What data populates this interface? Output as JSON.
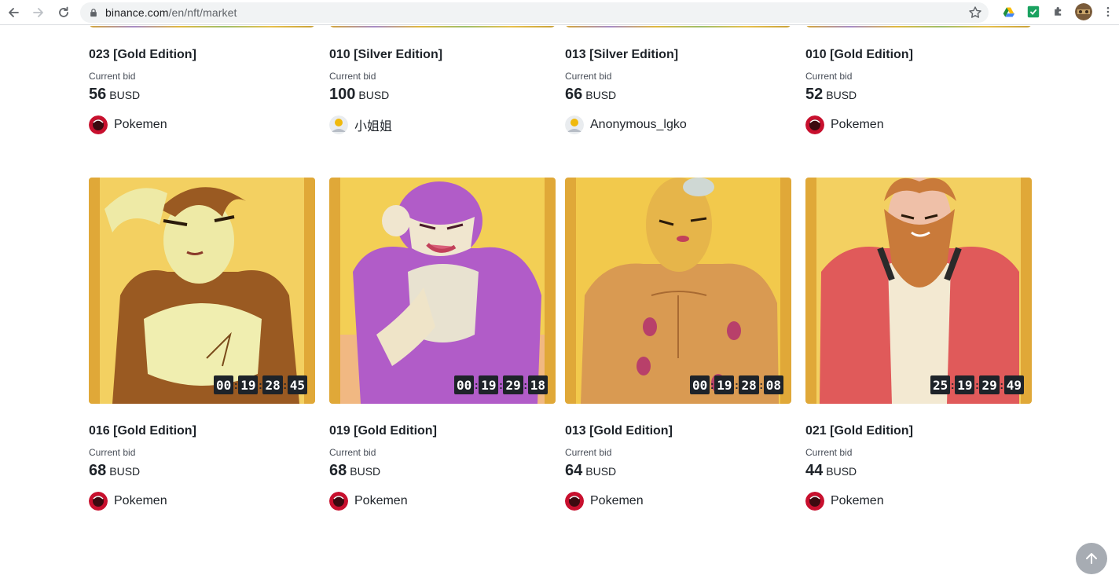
{
  "browser": {
    "url_host": "binance.com",
    "url_path": "/en/nft/market"
  },
  "top_row": [
    {
      "title": "023 [Gold Edition]",
      "bid_label": "Current bid",
      "bid_value": "56",
      "bid_unit": "BUSD",
      "creator": "Pokemen",
      "avatar": "pokemen"
    },
    {
      "title": "010 [Silver Edition]",
      "bid_label": "Current bid",
      "bid_value": "100",
      "bid_unit": "BUSD",
      "creator": "小姐姐",
      "avatar": "default"
    },
    {
      "title": "013 [Silver Edition]",
      "bid_label": "Current bid",
      "bid_value": "66",
      "bid_unit": "BUSD",
      "creator": "Anonymous_lgko",
      "avatar": "default"
    },
    {
      "title": "010 [Gold Edition]",
      "bid_label": "Current bid",
      "bid_value": "52",
      "bid_unit": "BUSD",
      "creator": "Pokemen",
      "avatar": "pokemen"
    }
  ],
  "bottom_row": [
    {
      "title": "016 [Gold Edition]",
      "bid_label": "Current bid",
      "bid_value": "68",
      "bid_unit": "BUSD",
      "creator": "Pokemen",
      "avatar": "pokemen",
      "countdown": [
        "00",
        "19",
        "28",
        "45"
      ]
    },
    {
      "title": "019 [Gold Edition]",
      "bid_label": "Current bid",
      "bid_value": "68",
      "bid_unit": "BUSD",
      "creator": "Pokemen",
      "avatar": "pokemen",
      "countdown": [
        "00",
        "19",
        "29",
        "18"
      ]
    },
    {
      "title": "013 [Gold Edition]",
      "bid_label": "Current bid",
      "bid_value": "64",
      "bid_unit": "BUSD",
      "creator": "Pokemen",
      "avatar": "pokemen",
      "countdown": [
        "00",
        "19",
        "28",
        "08"
      ]
    },
    {
      "title": "021 [Gold Edition]",
      "bid_label": "Current bid",
      "bid_value": "44",
      "bid_unit": "BUSD",
      "creator": "Pokemen",
      "avatar": "pokemen",
      "countdown": [
        "25",
        "19",
        "29",
        "49"
      ]
    }
  ],
  "countdown_sep": ":",
  "icons": {
    "back": "arrow-left-icon",
    "forward": "arrow-right-icon",
    "reload": "reload-icon",
    "lock": "lock-icon",
    "bookmark": "star-icon",
    "scroll_top": "arrow-up-icon"
  },
  "colors": {
    "text": "#1e2329",
    "secondary_text": "#474d57",
    "countdown_bg": "#1e2329",
    "gold": "#e7c04c"
  }
}
